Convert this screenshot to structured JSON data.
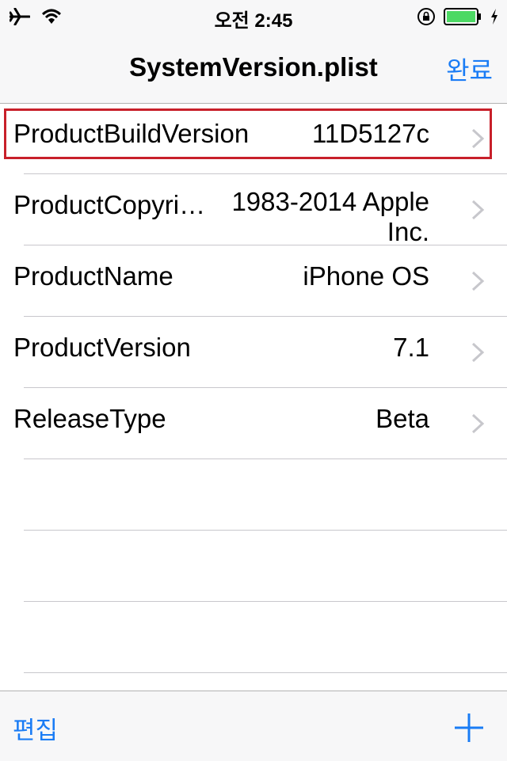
{
  "status_bar": {
    "time": "오전 2:45",
    "icons": [
      "airplane-icon",
      "wifi-icon",
      "orientation-lock-icon",
      "battery-icon",
      "charging-bolt-icon"
    ]
  },
  "nav": {
    "title": "SystemVersion.plist",
    "done_label": "완료"
  },
  "rows": [
    {
      "key": "ProductBuildVersion",
      "value": "11D5127c",
      "highlighted": true
    },
    {
      "key": "ProductCopyri…",
      "value": "1983-2014 Apple Inc."
    },
    {
      "key": "ProductName",
      "value": "iPhone OS"
    },
    {
      "key": "ProductVersion",
      "value": "7.1"
    },
    {
      "key": "ReleaseType",
      "value": "Beta"
    }
  ],
  "toolbar": {
    "edit_label": "편집",
    "add_icon": "plus-icon"
  },
  "colors": {
    "accent": "#1a7cf5",
    "highlight_border": "#c8202a",
    "battery_fill": "#4cd964"
  }
}
